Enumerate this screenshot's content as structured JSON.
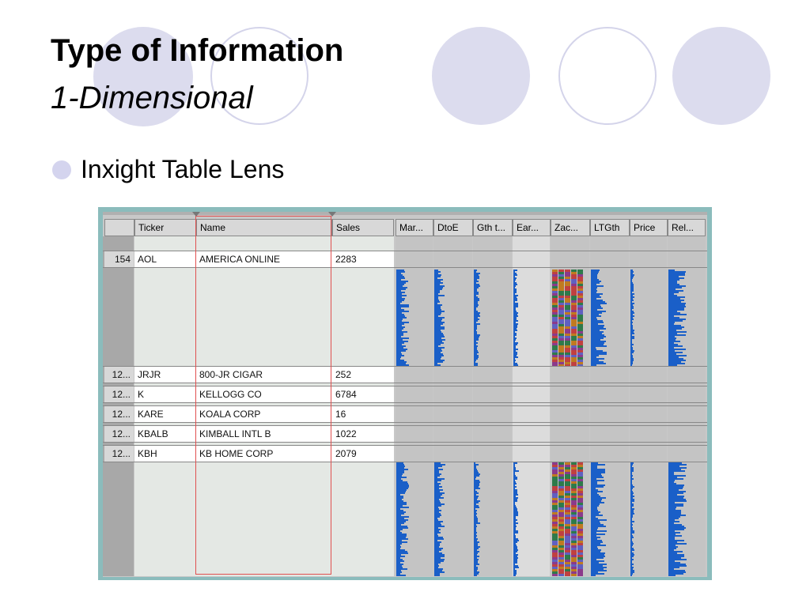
{
  "slide": {
    "title": "Type of Information",
    "subtitle": "1-Dimensional",
    "bullet": "Inxight Table Lens"
  },
  "colors": {
    "decor_fill": "#dcdcee",
    "bar_blue": "#1a5fc8",
    "selection_red": "#e05050",
    "frame_teal": "#8bbcbc"
  },
  "table_lens": {
    "headers": [
      "Ticker",
      "Name",
      "Sales",
      "Mar...",
      "DtoE",
      "Gth t...",
      "Ear...",
      "Zac...",
      "LTGth",
      "Price",
      "Rel..."
    ],
    "focus_rows": [
      {
        "num": "154",
        "ticker": "AOL",
        "name": "AMERICA ONLINE",
        "sales": "2283"
      },
      {
        "num": "12...",
        "ticker": "JRJR",
        "name": "800-JR CIGAR",
        "sales": "252"
      },
      {
        "num": "12...",
        "ticker": "K",
        "name": "KELLOGG CO",
        "sales": "6784"
      },
      {
        "num": "12...",
        "ticker": "KARE",
        "name": "KOALA CORP",
        "sales": "16"
      },
      {
        "num": "12...",
        "ticker": "KBALB",
        "name": "KIMBALL INTL  B",
        "sales": "1022"
      },
      {
        "num": "12...",
        "ticker": "KBH",
        "name": "KB HOME CORP",
        "sales": "2079"
      }
    ]
  }
}
